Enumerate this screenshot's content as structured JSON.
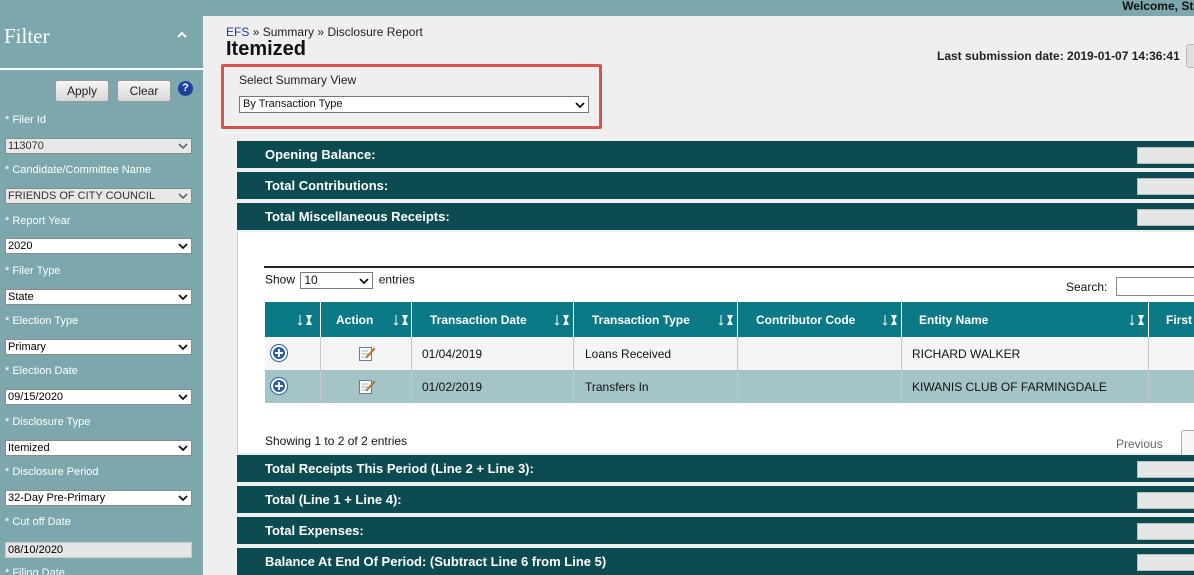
{
  "header": {
    "welcome": "Welcome, Stat"
  },
  "filter": {
    "title": "Filter",
    "apply_label": "Apply",
    "clear_label": "Clear",
    "help_glyph": "?",
    "fields": {
      "filer_id": {
        "label": "* Filer Id",
        "value": "113070"
      },
      "candidate": {
        "label": "* Candidate/Committee Name",
        "value": "FRIENDS OF CITY COUNCIL"
      },
      "report_year": {
        "label": "* Report Year",
        "value": "2020"
      },
      "filer_type": {
        "label": "* Filer Type",
        "value": "State"
      },
      "election_type": {
        "label": "* Election Type",
        "value": "Primary"
      },
      "election_date": {
        "label": "* Election Date",
        "value": "09/15/2020"
      },
      "disclosure_type": {
        "label": "* Disclosure Type",
        "value": "Itemized"
      },
      "disclosure_period": {
        "label": "* Disclosure Period",
        "value": "32-Day Pre-Primary"
      },
      "cutoff_date": {
        "label": "* Cut off Date",
        "value": "08/10/2020"
      },
      "filing_date": {
        "label": "* Filing Date"
      }
    }
  },
  "breadcrumb": {
    "root": "EFS",
    "sep": "»",
    "summary": "Summary",
    "current": "Disclosure Report"
  },
  "page_title": "Itemized",
  "last_submission": "Last submission date: 2019-01-07 14:36:41",
  "summary_view": {
    "label": "Select Summary View",
    "value": "By Transaction Type"
  },
  "sections": {
    "opening": "Opening Balance:",
    "contributions": "Total Contributions:",
    "misc_receipts": "Total Miscellaneous Receipts:",
    "receipts_period": "Total Receipts This Period (Line 2 + Line 3):",
    "total_1_4": "Total (Line 1 + Line 4):",
    "expenses": "Total Expenses:",
    "balance_end": "Balance At End Of Period: (Subtract Line 6 from Line 5)"
  },
  "table": {
    "show_label": "Show",
    "entries_value": "10",
    "entries_label": "entries",
    "search_label": "Search:",
    "columns": {
      "action": "Action",
      "date": "Transaction Date",
      "type": "Transaction Type",
      "code": "Contributor Code",
      "entity": "Entity Name",
      "first": "First"
    },
    "rows": [
      {
        "date": "01/04/2019",
        "type": "Loans Received",
        "code": "",
        "entity": "RICHARD WALKER"
      },
      {
        "date": "01/02/2019",
        "type": "Transfers In",
        "code": "",
        "entity": "KIWANIS CLUB OF FARMINGDALE"
      }
    ],
    "showing": "Showing 1 to 2 of 2 entries",
    "previous": "Previous"
  }
}
